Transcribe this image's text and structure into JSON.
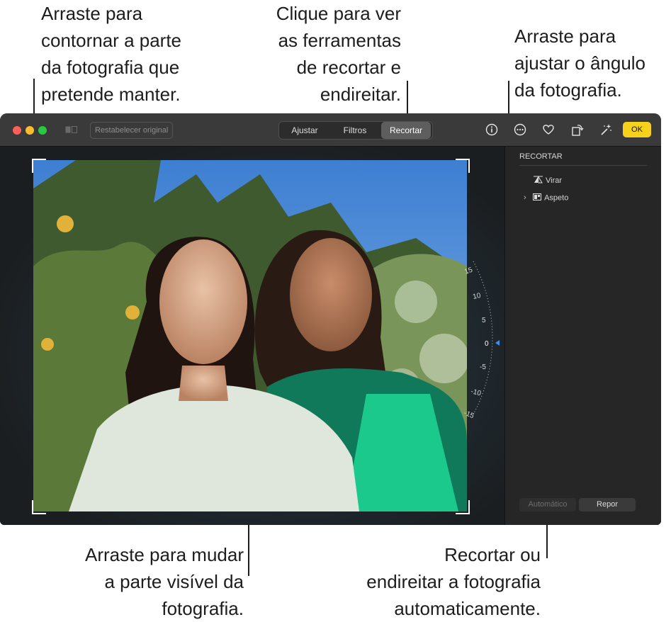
{
  "callouts": {
    "crop_handles": "Arraste para\ncontornar a parte\nda fotografia que\npretende manter.",
    "crop_tab": "Clique para ver\nas ferramentas\nde recortar e\nendireitar.",
    "angle": "Arraste para\najustar o ângulo\nda fotografia.",
    "drag_image": "Arraste para mudar\na parte visível da\nfotografia.",
    "auto": "Recortar ou\nendireitar a fotografia\nautomaticamente."
  },
  "toolbar": {
    "restore_label": "Restabelecer original",
    "tabs": [
      {
        "label": "Ajustar",
        "active": false
      },
      {
        "label": "Filtros",
        "active": false
      },
      {
        "label": "Recortar",
        "active": true
      }
    ],
    "ok_label": "OK",
    "icons": [
      "info-icon",
      "more-icon",
      "heart-icon",
      "rotate-icon",
      "magic-wand-icon"
    ]
  },
  "dial": {
    "ticks": [
      "15",
      "10",
      "5",
      "0",
      "-5",
      "-10",
      "-15"
    ],
    "value": 0
  },
  "sidebar": {
    "heading": "RECORTAR",
    "flip_label": "Virar",
    "aspect_label": "Aspeto",
    "auto_label": "Automático",
    "reset_label": "Repor"
  },
  "colors": {
    "accent_ok": "#f7d21c",
    "close": "#ff5f57",
    "minimize": "#febc2e",
    "zoom": "#28c840",
    "dial_marker": "#3d8ef0"
  }
}
